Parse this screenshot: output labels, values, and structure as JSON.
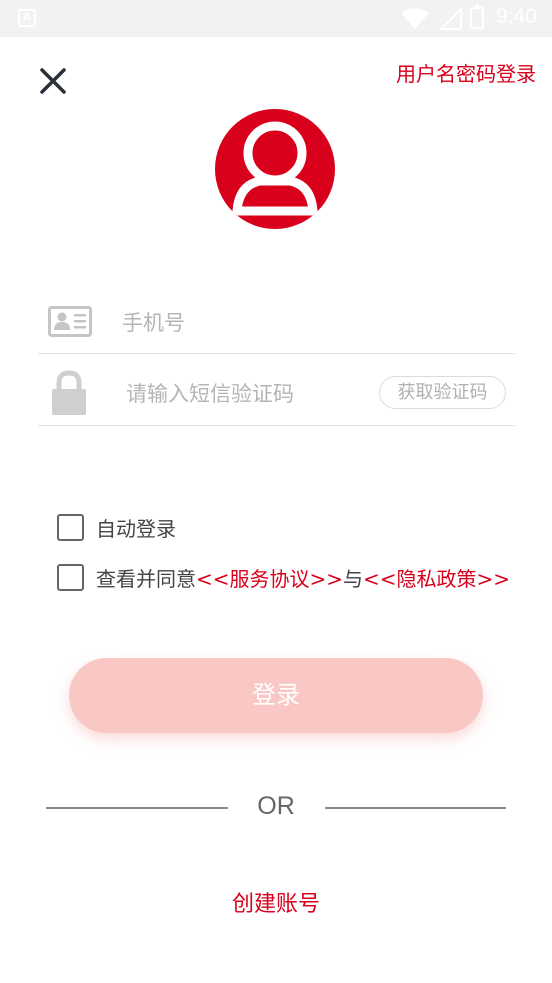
{
  "status_bar": {
    "time": "9:40"
  },
  "header": {
    "switch_login_label": "用户名密码登录"
  },
  "phone_field": {
    "placeholder": "手机号",
    "value": ""
  },
  "code_field": {
    "placeholder": "请输入短信验证码",
    "value": "",
    "get_code_label": "获取验证码"
  },
  "auto_login": {
    "label": "自动登录",
    "checked": false
  },
  "agreement": {
    "checked": false,
    "prefix": "查看并同意",
    "service_link": "<<服务协议>>",
    "connector": "与",
    "privacy_link": "<<隐私政策>>"
  },
  "login_button": {
    "label": "登录"
  },
  "divider": {
    "text": "OR"
  },
  "create_account": {
    "label": "创建账号"
  },
  "colors": {
    "accent": "#d9001b",
    "button_disabled": "#f9c8c4"
  }
}
